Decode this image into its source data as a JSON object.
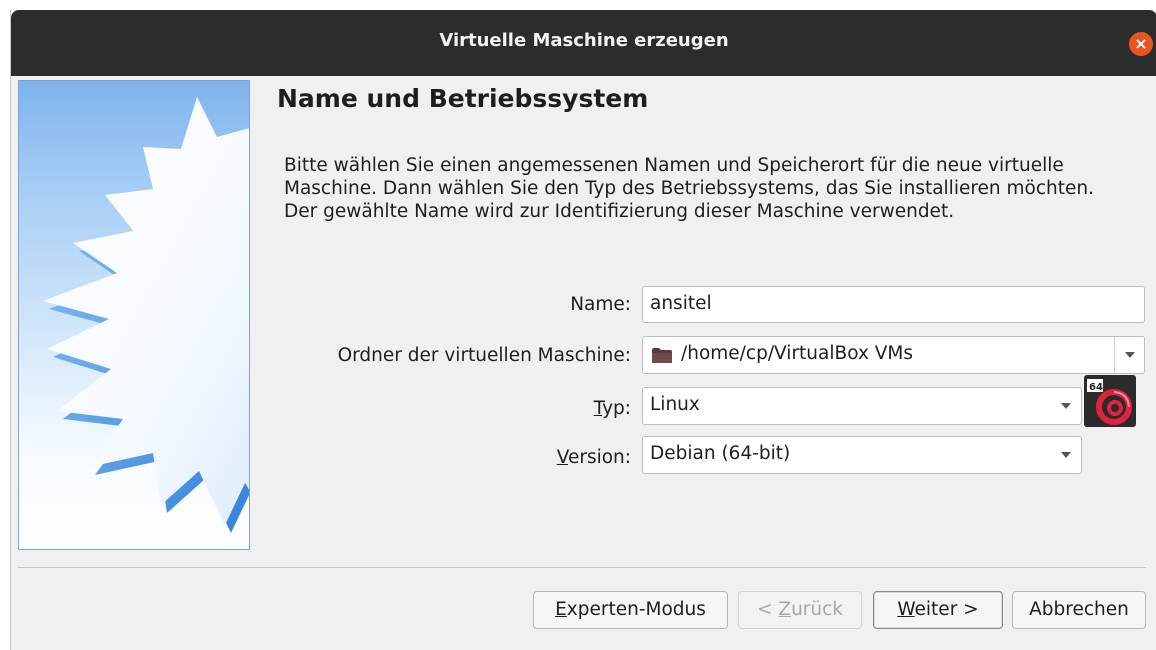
{
  "window": {
    "title": "Virtuelle Maschine erzeugen",
    "close_symbol": "×"
  },
  "page": {
    "heading": "Name und Betriebssystem",
    "description": "Bitte wählen Sie einen angemessenen Namen und Speicherort für die neue virtuelle Maschine. Dann wählen Sie den Typ des Betriebssystems, das Sie installieren möchten. Der gewählte Name wird zur Identifizierung dieser Maschine verwendet."
  },
  "form": {
    "name_label": "Name:",
    "name_value": "ansitel",
    "folder_label": "Ordner der virtuellen Maschine:",
    "folder_value": "/home/cp/VirtualBox VMs",
    "type_label_mnemonic": "T",
    "type_label_rest": "yp:",
    "type_value": "Linux",
    "version_label_mnemonic": "V",
    "version_label_rest": "ersion:",
    "version_value": "Debian (64-bit)",
    "os_icon_badge": "64"
  },
  "buttons": {
    "expert_mnemonic": "E",
    "expert_rest": "xperten-Modus",
    "back_prefix": "< ",
    "back_mnemonic": "Z",
    "back_rest": "urück",
    "next_mnemonic": "W",
    "next_rest": "eiter >",
    "cancel": "Abbrechen"
  },
  "icons": {
    "folder": "folder-icon",
    "os": "debian-os-icon",
    "wizard": "wizard-starburst-image"
  },
  "colors": {
    "titlebar": "#2c2c2c",
    "close": "#e95420",
    "dialog_bg": "#f0f0f0"
  }
}
